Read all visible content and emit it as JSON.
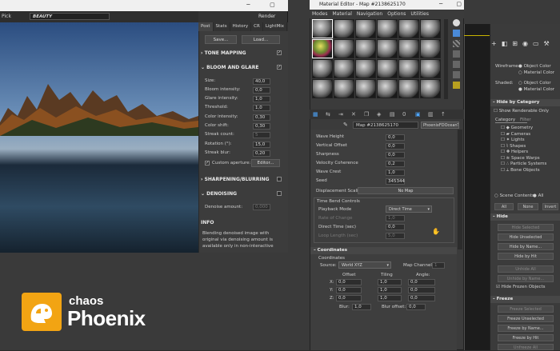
{
  "vfb": {
    "toolbar": {
      "pick": "Pick",
      "channel": "BEAUTY",
      "render": "Render"
    },
    "tabs": [
      "Post",
      "Stats",
      "History",
      "CR",
      "LightMix"
    ],
    "save": "Save...",
    "load": "Load...",
    "tone_mapping": "TONE MAPPING",
    "bloom": "BLOOM AND GLARE",
    "params": [
      {
        "label": "Size:",
        "value": "40,0"
      },
      {
        "label": "Bloom intensity:",
        "value": "0,0"
      },
      {
        "label": "Glare intensity:",
        "value": "1,0"
      },
      {
        "label": "Threshold:",
        "value": "1,0"
      },
      {
        "label": "Color intensity:",
        "value": "0,30"
      },
      {
        "label": "Color shift:",
        "value": "0,30"
      },
      {
        "label": "Streak count:",
        "value": "5"
      },
      {
        "label": "Rotation (°):",
        "value": "15,0"
      },
      {
        "label": "Streak blur:",
        "value": "0,20"
      }
    ],
    "custom_aperture": "Custom aperture:",
    "editor": "Editor...",
    "sharpening": "SHARPENING/BLURRING",
    "denoising": "DENOISING",
    "denoise_amount_label": "Denoise amount:",
    "denoise_amount": "0,000",
    "info": "INFO",
    "info_text": "Blending denoised image with original via denoising amount is available only in non-interactive"
  },
  "material_editor": {
    "title": "Material Editor - Map #2138625170",
    "menu": [
      "Modes",
      "Material",
      "Navigation",
      "Options",
      "Utilities"
    ],
    "map_name": "Map #2138625170",
    "map_type": "PhoenixFDOceanTex",
    "params": [
      {
        "label": "Wave Height",
        "value": "0,0"
      },
      {
        "label": "Vertical Offset",
        "value": "0,0"
      },
      {
        "label": "Sharpness",
        "value": "0,0"
      },
      {
        "label": "Velocity Coherence",
        "value": "0,2"
      },
      {
        "label": "Wave Crest",
        "value": "1,0"
      },
      {
        "label": "Seed",
        "value": "345344"
      }
    ],
    "displacement_scaling": "Displacement Scaling:",
    "no_map": "No Map",
    "time_bend": "Time Bend Controls",
    "playback_mode": "Playback Mode",
    "playback_value": "Direct Time",
    "rate_of_change": "Rate of Change",
    "rate_value": "1,0",
    "direct_time": "Direct Time (sec)",
    "direct_time_value": "0,0",
    "loop_length": "Loop Length (sec)",
    "loop_value": "5,0",
    "coordinates_rollout": "Coordinates",
    "coordinates": "Coordinates",
    "source": "Source:",
    "source_value": "World XYZ",
    "map_channel": "Map Channel:",
    "map_channel_value": "1",
    "headers": [
      "Offset",
      "Tiling",
      "Angle:"
    ],
    "axes": [
      {
        "axis": "X:",
        "offset": "0,0",
        "tiling": "1,0",
        "angle": "0,0"
      },
      {
        "axis": "Y:",
        "offset": "0,0",
        "tiling": "1,0",
        "angle": "0,0"
      },
      {
        "axis": "Z:",
        "offset": "0,0",
        "tiling": "1,0",
        "angle": "0,0"
      }
    ],
    "blur": "Blur:",
    "blur_value": "1,0",
    "blur_offset": "Blur offset:",
    "blur_offset_value": "0,0"
  },
  "command_panel": {
    "wireframe": "Wireframe:",
    "object_color": "Object Color",
    "material_color": "Material Color",
    "shaded": "Shaded:",
    "hide_by_category": "Hide by Category",
    "show_renderable": "Show Renderable Only",
    "category": "Category",
    "filter": "Filter",
    "categories": [
      "Geometry",
      "Cameras",
      "Lights",
      "Shapes",
      "Helpers",
      "Space Warps",
      "Particle Systems",
      "Bone Objects"
    ],
    "scene_contents": "Scene Contents",
    "all": "All",
    "filter_buttons": [
      "All",
      "None",
      "Invert"
    ],
    "hide": "Hide",
    "hide_buttons": [
      "Hide Selected",
      "Hide Unselected",
      "Hide by Name...",
      "Hide by Hit",
      "Unhide All",
      "Unhide by Name..."
    ],
    "hide_frozen": "Hide Frozen Objects",
    "freeze": "Freeze",
    "freeze_buttons": [
      "Freeze Selected",
      "Freeze Unselected",
      "Freeze by Name...",
      "Freeze by Hit",
      "Unfreeze All"
    ]
  },
  "logo": {
    "chaos": "chaos",
    "phoenix": "Phoenix"
  },
  "colors": {
    "accent": "#f2a413",
    "viewport_line": "#c8b400"
  }
}
